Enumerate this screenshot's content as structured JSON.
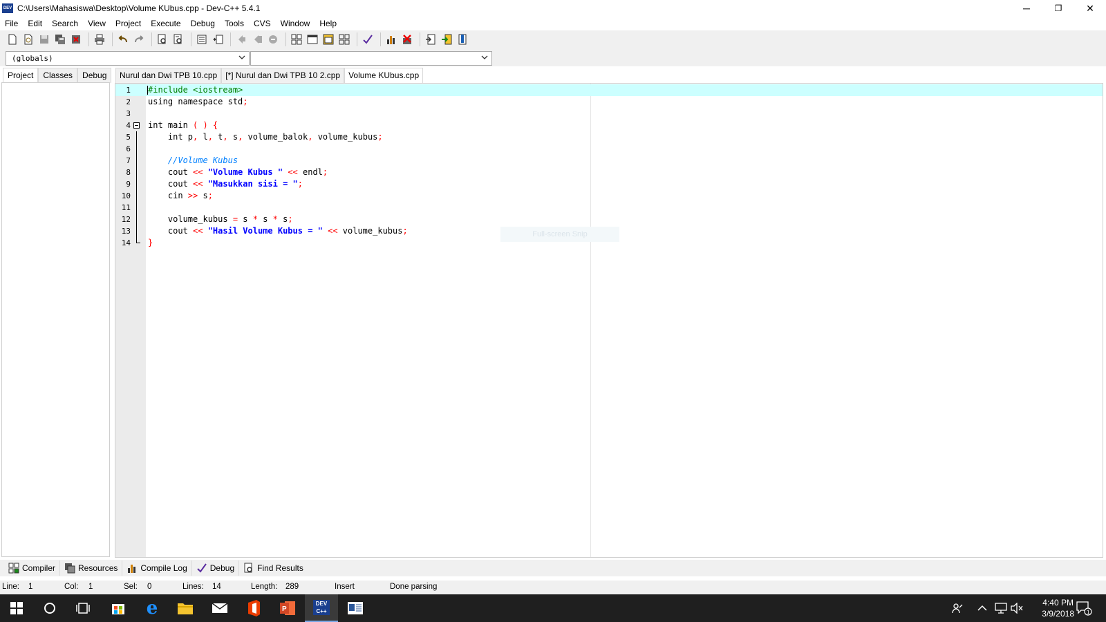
{
  "window": {
    "title": "C:\\Users\\Mahasiswa\\Desktop\\Volume KUbus.cpp - Dev-C++ 5.4.1",
    "app_icon_text": "DEV",
    "minimize": "─",
    "restore": "❐",
    "close": "✕"
  },
  "menu": [
    "File",
    "Edit",
    "Search",
    "View",
    "Project",
    "Execute",
    "Debug",
    "Tools",
    "CVS",
    "Window",
    "Help"
  ],
  "toolbar_icons": [
    "new-file-icon",
    "open-file-icon",
    "save-icon",
    "save-all-icon",
    "close-file-icon",
    "print-icon",
    "undo-icon",
    "redo-icon",
    "find-icon",
    "replace-icon",
    "indent-icon",
    "unindent-icon",
    "back-icon",
    "forward-icon",
    "goto-icon",
    "new-project-icon",
    "window-icon",
    "class-icon",
    "layout-icon",
    "check-icon",
    "chart-icon",
    "delete-icon",
    "compile-icon",
    "run-icon",
    "bookmark-icon"
  ],
  "combos": {
    "scope": "(globals)",
    "member": ""
  },
  "left_tabs": [
    "Project",
    "Classes",
    "Debug"
  ],
  "editor_tabs": [
    "Nurul dan Dwi TPB 10.cpp",
    "[*] Nurul dan Dwi TPB 10 2.cpp",
    "Volume KUbus.cpp"
  ],
  "code": {
    "line_numbers": [
      "1",
      "2",
      "3",
      "4",
      "5",
      "6",
      "7",
      "8",
      "9",
      "10",
      "11",
      "12",
      "13",
      "14"
    ],
    "lines": [
      [
        {
          "t": "#include <iostream>",
          "c": "#008000"
        }
      ],
      [
        {
          "t": "using namespace std",
          "c": "#000000"
        },
        {
          "t": ";",
          "c": "#ff0000"
        }
      ],
      [],
      [
        {
          "t": "int main ",
          "c": "#000000"
        },
        {
          "t": "( ) {",
          "c": "#ff0000"
        }
      ],
      [
        {
          "t": "    int p",
          "c": "#000000"
        },
        {
          "t": ", ",
          "c": "#ff0000"
        },
        {
          "t": "l",
          "c": "#000000"
        },
        {
          "t": ", ",
          "c": "#ff0000"
        },
        {
          "t": "t",
          "c": "#000000"
        },
        {
          "t": ", ",
          "c": "#ff0000"
        },
        {
          "t": "s",
          "c": "#000000"
        },
        {
          "t": ", ",
          "c": "#ff0000"
        },
        {
          "t": "volume_balok",
          "c": "#000000"
        },
        {
          "t": ", ",
          "c": "#ff0000"
        },
        {
          "t": "volume_kubus",
          "c": "#000000"
        },
        {
          "t": ";",
          "c": "#ff0000"
        }
      ],
      [],
      [
        {
          "t": "    //Volume Kubus",
          "c": "#0080ff",
          "i": true
        }
      ],
      [
        {
          "t": "    cout ",
          "c": "#000000"
        },
        {
          "t": "<<",
          "c": "#ff0000"
        },
        {
          "t": " \"Volume Kubus \" ",
          "c": "#0000ff",
          "b": true
        },
        {
          "t": "<<",
          "c": "#ff0000"
        },
        {
          "t": " endl",
          "c": "#000000"
        },
        {
          "t": ";",
          "c": "#ff0000"
        }
      ],
      [
        {
          "t": "    cout ",
          "c": "#000000"
        },
        {
          "t": "<<",
          "c": "#ff0000"
        },
        {
          "t": " \"Masukkan sisi = \"",
          "c": "#0000ff",
          "b": true
        },
        {
          "t": ";",
          "c": "#ff0000"
        }
      ],
      [
        {
          "t": "    cin ",
          "c": "#000000"
        },
        {
          "t": ">>",
          "c": "#ff0000"
        },
        {
          "t": " s",
          "c": "#000000"
        },
        {
          "t": ";",
          "c": "#ff0000"
        }
      ],
      [],
      [
        {
          "t": "    volume_kubus ",
          "c": "#000000"
        },
        {
          "t": "=",
          "c": "#ff0000"
        },
        {
          "t": " s ",
          "c": "#000000"
        },
        {
          "t": "*",
          "c": "#ff0000"
        },
        {
          "t": " s ",
          "c": "#000000"
        },
        {
          "t": "*",
          "c": "#ff0000"
        },
        {
          "t": " s",
          "c": "#000000"
        },
        {
          "t": ";",
          "c": "#ff0000"
        }
      ],
      [
        {
          "t": "    cout ",
          "c": "#000000"
        },
        {
          "t": "<<",
          "c": "#ff0000"
        },
        {
          "t": " \"Hasil Volume Kubus = \" ",
          "c": "#0000ff",
          "b": true
        },
        {
          "t": "<<",
          "c": "#ff0000"
        },
        {
          "t": " volume_kubus",
          "c": "#000000"
        },
        {
          "t": ";",
          "c": "#ff0000"
        }
      ],
      [
        {
          "t": "}",
          "c": "#ff0000"
        }
      ]
    ]
  },
  "overlay_text": "Full-screen Snip",
  "bottom_tabs": [
    {
      "label": "Compiler",
      "icon": "compiler-icon"
    },
    {
      "label": "Resources",
      "icon": "resources-icon"
    },
    {
      "label": "Compile Log",
      "icon": "compile-log-icon"
    },
    {
      "label": "Debug",
      "icon": "debug-icon"
    },
    {
      "label": "Find Results",
      "icon": "find-results-icon"
    }
  ],
  "status": {
    "line_label": "Line:",
    "line_value": "1",
    "col_label": "Col:",
    "col_value": "1",
    "sel_label": "Sel:",
    "sel_value": "0",
    "lines_label": "Lines:",
    "lines_value": "14",
    "length_label": "Length:",
    "length_value": "289",
    "mode": "Insert",
    "message": "Done parsing"
  },
  "taskbar": {
    "apps": [
      "windows-start-icon",
      "cortana-icon",
      "task-view-icon",
      "store-icon",
      "edge-icon",
      "file-explorer-icon",
      "mail-icon",
      "office-icon",
      "powerpoint-icon",
      "devcpp-icon",
      "word-icon"
    ],
    "time": "4:40 PM",
    "date": "3/9/2018",
    "notification_count": "1"
  },
  "colors": {
    "current_line": "#ccffff",
    "keyword": "#000000",
    "symbol": "#ff0000",
    "string": "#0000ff",
    "comment": "#0080ff",
    "preprocessor": "#008000"
  }
}
